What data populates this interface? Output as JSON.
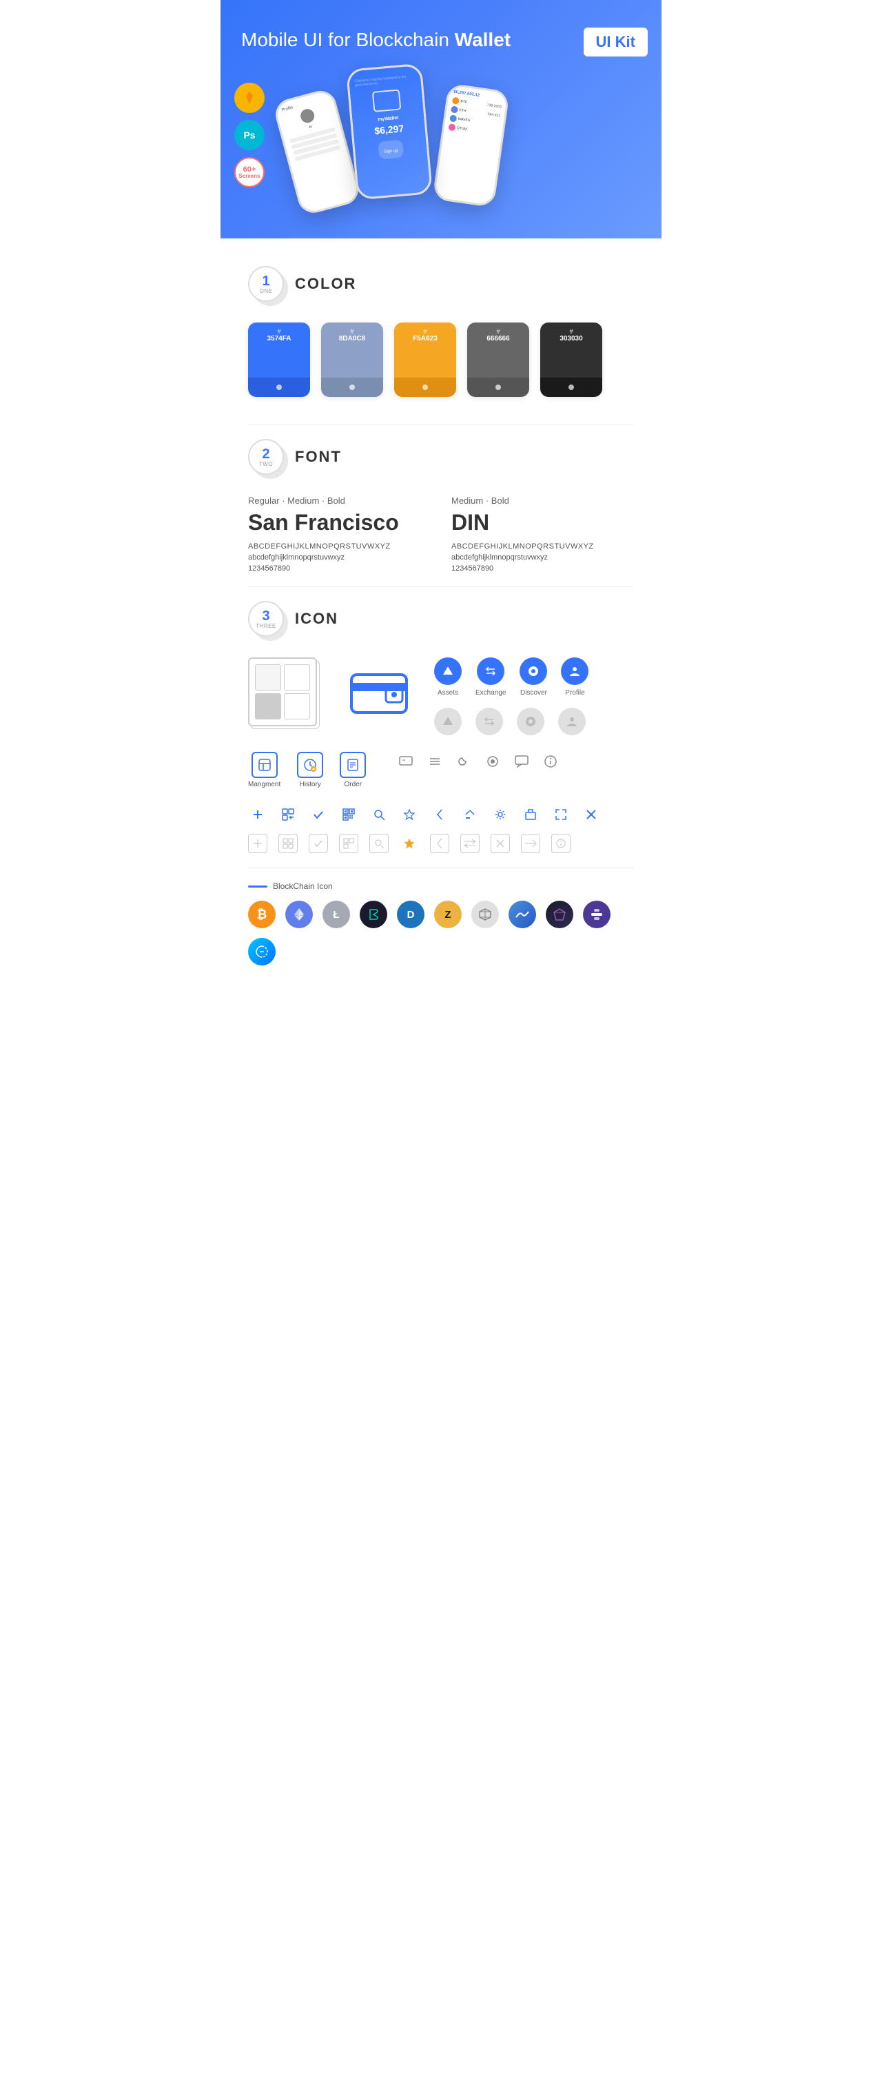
{
  "hero": {
    "title_start": "Mobile UI for Blockchain ",
    "title_bold": "Wallet",
    "badge": "UI Kit",
    "badge_sketch": "Sketch",
    "badge_ps": "Ps",
    "badge_screens_count": "60+",
    "badge_screens_label": "Screens"
  },
  "sections": {
    "color": {
      "number": "1",
      "word": "ONE",
      "title": "COLOR",
      "swatches": [
        {
          "hex": "#3574FA",
          "display": "#\n3574FA",
          "label": "3574FA"
        },
        {
          "hex": "#8DA0C8",
          "display": "#\n8DA0C8",
          "label": "8DA0C8"
        },
        {
          "hex": "#F5A623",
          "display": "#\nF5A623",
          "label": "F5A623"
        },
        {
          "hex": "#666666",
          "display": "#\n666666",
          "label": "666666"
        },
        {
          "hex": "#303030",
          "display": "#\n303030",
          "label": "303030"
        }
      ]
    },
    "font": {
      "number": "2",
      "word": "TWO",
      "title": "FONT",
      "fonts": [
        {
          "style_label": "Regular · Medium · Bold",
          "name": "San Francisco",
          "uppercase": "ABCDEFGHIJKLMNOPQRSTUVWXYZ",
          "lowercase": "abcdefghijklmnopqrstuvwxyz",
          "numbers": "1234567890"
        },
        {
          "style_label": "Medium · Bold",
          "name": "DIN",
          "uppercase": "ABCDEFGHIJKLMNOPQRSTUVWXYZ",
          "lowercase": "abcdefghijklmnopqrstuvwxyz",
          "numbers": "1234567890"
        }
      ]
    },
    "icon": {
      "number": "3",
      "word": "THREE",
      "title": "ICON",
      "nav_icons": [
        {
          "label": "Assets",
          "symbol": "◆"
        },
        {
          "label": "Exchange",
          "symbol": "⇌"
        },
        {
          "label": "Discover",
          "symbol": "●"
        },
        {
          "label": "Profile",
          "symbol": "👤"
        }
      ],
      "nav_icons_grey": [
        {
          "label": "",
          "symbol": "◆"
        },
        {
          "label": "",
          "symbol": "⇌"
        },
        {
          "label": "",
          "symbol": "●"
        },
        {
          "label": "",
          "symbol": "👤"
        }
      ],
      "bottom_icons": [
        {
          "label": "Mangment",
          "symbol": "▣"
        },
        {
          "label": "History",
          "symbol": "🕐"
        },
        {
          "label": "Order",
          "symbol": "📋"
        }
      ],
      "small_icons_blue": [
        "+",
        "⊞",
        "✓",
        "⊡",
        "🔍",
        "☆",
        "<",
        "⇐",
        "⚙",
        "⊡",
        "⊠",
        "✕"
      ],
      "small_icons_grey": [
        "+",
        "⊞",
        "✓",
        "⊡",
        "🔍",
        "☆",
        "<",
        "⇐",
        "⊡",
        "→",
        "ℹ"
      ],
      "misc_icons": [
        "💬",
        "≡",
        "◑",
        "●",
        "💬",
        "ℹ"
      ],
      "blockchain_label": "BlockChain Icon",
      "crypto_coins": [
        {
          "symbol": "₿",
          "name": "BTC",
          "class": "crypto-btc"
        },
        {
          "symbol": "Ξ",
          "name": "ETH",
          "class": "crypto-eth"
        },
        {
          "symbol": "Ł",
          "name": "LTC",
          "class": "crypto-ltc"
        },
        {
          "symbol": "◈",
          "name": "BSV",
          "class": "crypto-bsv"
        },
        {
          "symbol": "D",
          "name": "DASH",
          "class": "crypto-dash"
        },
        {
          "symbol": "Z",
          "name": "ZEC",
          "class": "crypto-zcash"
        },
        {
          "symbol": "⬡",
          "name": "GRID",
          "class": "crypto-grid"
        },
        {
          "symbol": "W",
          "name": "WAVES",
          "class": "crypto-waves"
        },
        {
          "symbol": "◈",
          "name": "GEM",
          "class": "crypto-gem"
        },
        {
          "symbol": "B",
          "name": "BAND",
          "class": "crypto-band"
        },
        {
          "symbol": "∞",
          "name": "LINK",
          "class": "crypto-link"
        }
      ]
    }
  }
}
